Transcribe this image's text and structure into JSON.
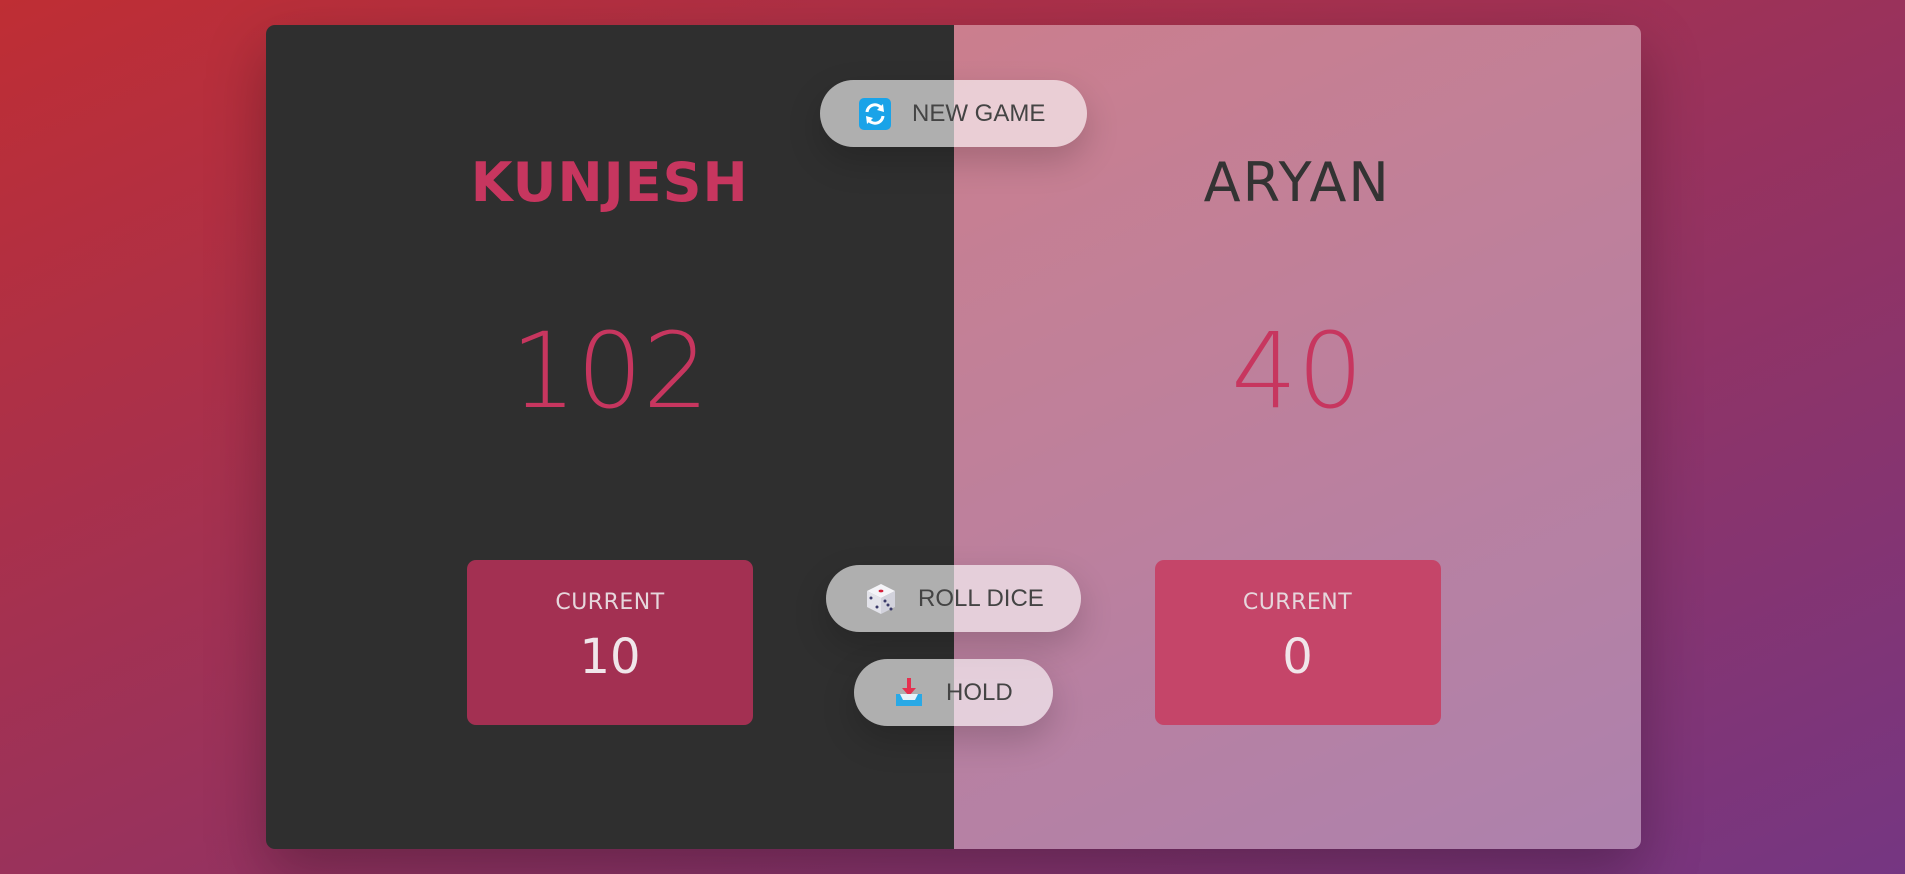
{
  "players": [
    {
      "name": "KUNJESH",
      "score": "102",
      "current_label": "CURRENT",
      "current_score": "10",
      "active": false
    },
    {
      "name": "ARYAN",
      "score": "40",
      "current_label": "CURRENT",
      "current_score": "0",
      "active": true
    }
  ],
  "buttons": {
    "new_game": {
      "label": "NEW GAME",
      "icon": "refresh-icon"
    },
    "roll_dice": {
      "label": "ROLL DICE",
      "icon": "dice-icon"
    },
    "hold": {
      "label": "HOLD",
      "icon": "inbox-tray-icon"
    }
  },
  "colors": {
    "accent": "#c7365f",
    "background_gradient": [
      "#bf2e34",
      "#753682"
    ],
    "player0_bg": "#2f2f2f"
  }
}
